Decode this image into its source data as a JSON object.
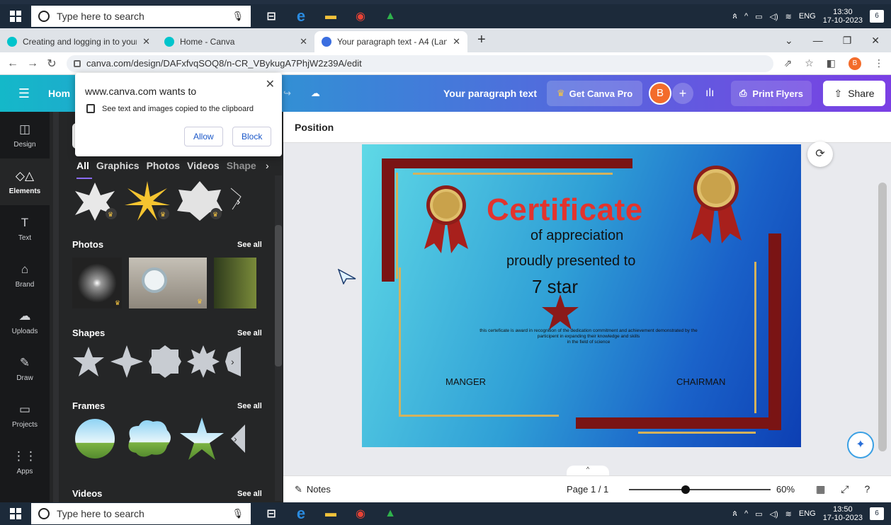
{
  "taskbar": {
    "search_placeholder": "Type here to search",
    "time_top": "13:30",
    "date_top": "17-10-2023",
    "time_bottom": "13:50",
    "date_bottom": "17-10-2023",
    "lang": "ENG",
    "notif_count": "6"
  },
  "browser": {
    "tabs": [
      {
        "label": "Creating and logging in to your C"
      },
      {
        "label": "Home - Canva"
      },
      {
        "label": "Your paragraph text - A4 (Landsc"
      }
    ],
    "url": "canva.com/design/DAFxfvqSOQ8/n-CR_VBykugA7PhjW2z39A/edit",
    "profile_initial": "B"
  },
  "canva_header": {
    "home": "Hom",
    "doc_title": "Your paragraph text",
    "get_pro": "Get Canva Pro",
    "avatar": "B",
    "print": "Print Flyers",
    "share": "Share"
  },
  "rail": [
    {
      "label": "Design",
      "icon": "design-icon",
      "glyph": "◫"
    },
    {
      "label": "Elements",
      "icon": "elements-icon",
      "glyph": "◇△"
    },
    {
      "label": "Text",
      "icon": "text-icon",
      "glyph": "T"
    },
    {
      "label": "Brand",
      "icon": "brand-icon",
      "glyph": "⌂"
    },
    {
      "label": "Uploads",
      "icon": "uploads-icon",
      "glyph": "☁"
    },
    {
      "label": "Draw",
      "icon": "draw-icon",
      "glyph": "✎"
    },
    {
      "label": "Projects",
      "icon": "projects-icon",
      "glyph": "▭"
    },
    {
      "label": "Apps",
      "icon": "apps-icon",
      "glyph": "⋮⋮"
    }
  ],
  "panel": {
    "tabs": [
      "All",
      "Graphics",
      "Photos",
      "Videos",
      "Shape"
    ],
    "photos": "Photos",
    "shapes": "Shapes",
    "frames": "Frames",
    "videos": "Videos",
    "see_all": "See all"
  },
  "popup": {
    "title": "www.canva.com wants to",
    "line": "See text and images copied to the clipboard",
    "allow": "Allow",
    "block": "Block"
  },
  "workspace": {
    "position_label": "Position",
    "notes": "Notes",
    "page": "Page 1 / 1",
    "zoom": "60%",
    "zoom_fraction": 0.4
  },
  "certificate": {
    "title": "Certificate",
    "subtitle": "of appreciation",
    "presented": "proudly presented to",
    "name": "7 star",
    "body_line1": "this certeficate is award in recognition of the dedication commitment and achievement demonstrated by the",
    "body_line2": "participent in expanding their knowledge and skills",
    "body_line3": "in the field of science",
    "sign_left": "MANGER",
    "sign_right": "CHAIRMAN"
  },
  "colors": {
    "accent_red": "#e2342e",
    "ribbon_dark": "#7a1414",
    "gold": "#d4b25c",
    "canva_purple": "#7b3fe4",
    "canva_teal": "#14b8c9"
  }
}
